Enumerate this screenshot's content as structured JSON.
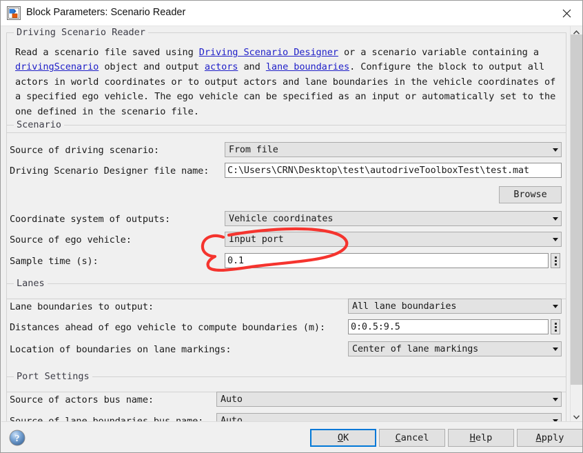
{
  "window": {
    "title": "Block Parameters: Scenario Reader",
    "icon": "simulink-block-icon",
    "close_icon": "close-icon"
  },
  "description_group": {
    "label": "Driving Scenario Reader",
    "paragraph": {
      "seg1": "Read a scenario file saved using ",
      "link1": "Driving Scenario Designer",
      "seg2": " or a scenario variable containing a ",
      "link2": "drivingScenario",
      "seg3": " object and output ",
      "link3": "actors",
      "seg4": " and ",
      "link4": "lane boundaries",
      "seg5": ". Configure the block to output all actors in world coordinates or to output actors and lane boundaries in the vehicle coordinates of a specified ego vehicle. The ego vehicle can be specified as an input or automatically set to the one defined in the scenario file."
    }
  },
  "scenario_group": {
    "label": "Scenario",
    "source_label": "Source of driving scenario:",
    "source_value": "From file",
    "file_label": "Driving Scenario Designer file name:",
    "file_value": "C:\\Users\\CRN\\Desktop\\test\\autodriveToolboxTest\\test.mat",
    "browse_label": "Browse",
    "coord_label": "Coordinate system of outputs:",
    "coord_value": "Vehicle coordinates",
    "ego_label": "Source of ego vehicle:",
    "ego_value": "Input port",
    "sample_label": "Sample time (s):",
    "sample_value": "0.1"
  },
  "lanes_group": {
    "label": "Lanes",
    "boundaries_label": "Lane boundaries to output:",
    "boundaries_value": "All lane boundaries",
    "distances_label": "Distances ahead of ego vehicle to compute boundaries (m):",
    "distances_value": "0:0.5:9.5",
    "location_label": "Location of boundaries on lane markings:",
    "location_value": "Center of lane markings"
  },
  "port_group": {
    "label": "Port Settings",
    "actors_bus_label": "Source of actors bus name:",
    "actors_bus_value": "Auto",
    "lane_bus_label": "Source of lane boundaries bus name:",
    "lane_bus_value": "Auto"
  },
  "buttons": {
    "ok": {
      "pre": "",
      "mnemonic": "O",
      "post": "K"
    },
    "cancel": {
      "pre": "",
      "mnemonic": "C",
      "post": "ancel"
    },
    "help": {
      "pre": "",
      "mnemonic": "H",
      "post": "elp"
    },
    "apply": {
      "pre": "",
      "mnemonic": "A",
      "post": "pply"
    }
  },
  "help_icon": "question-mark-help-icon",
  "annotation": {
    "kind": "hand-drawn-red-circle",
    "target": "Input port",
    "color": "#f5342e"
  },
  "colors": {
    "dialog_bg": "#f0f0f0",
    "combo_bg": "#e3e3e3",
    "link": "#2020c8",
    "focus_border": "#0078d7",
    "annotation_red": "#f5342e"
  }
}
